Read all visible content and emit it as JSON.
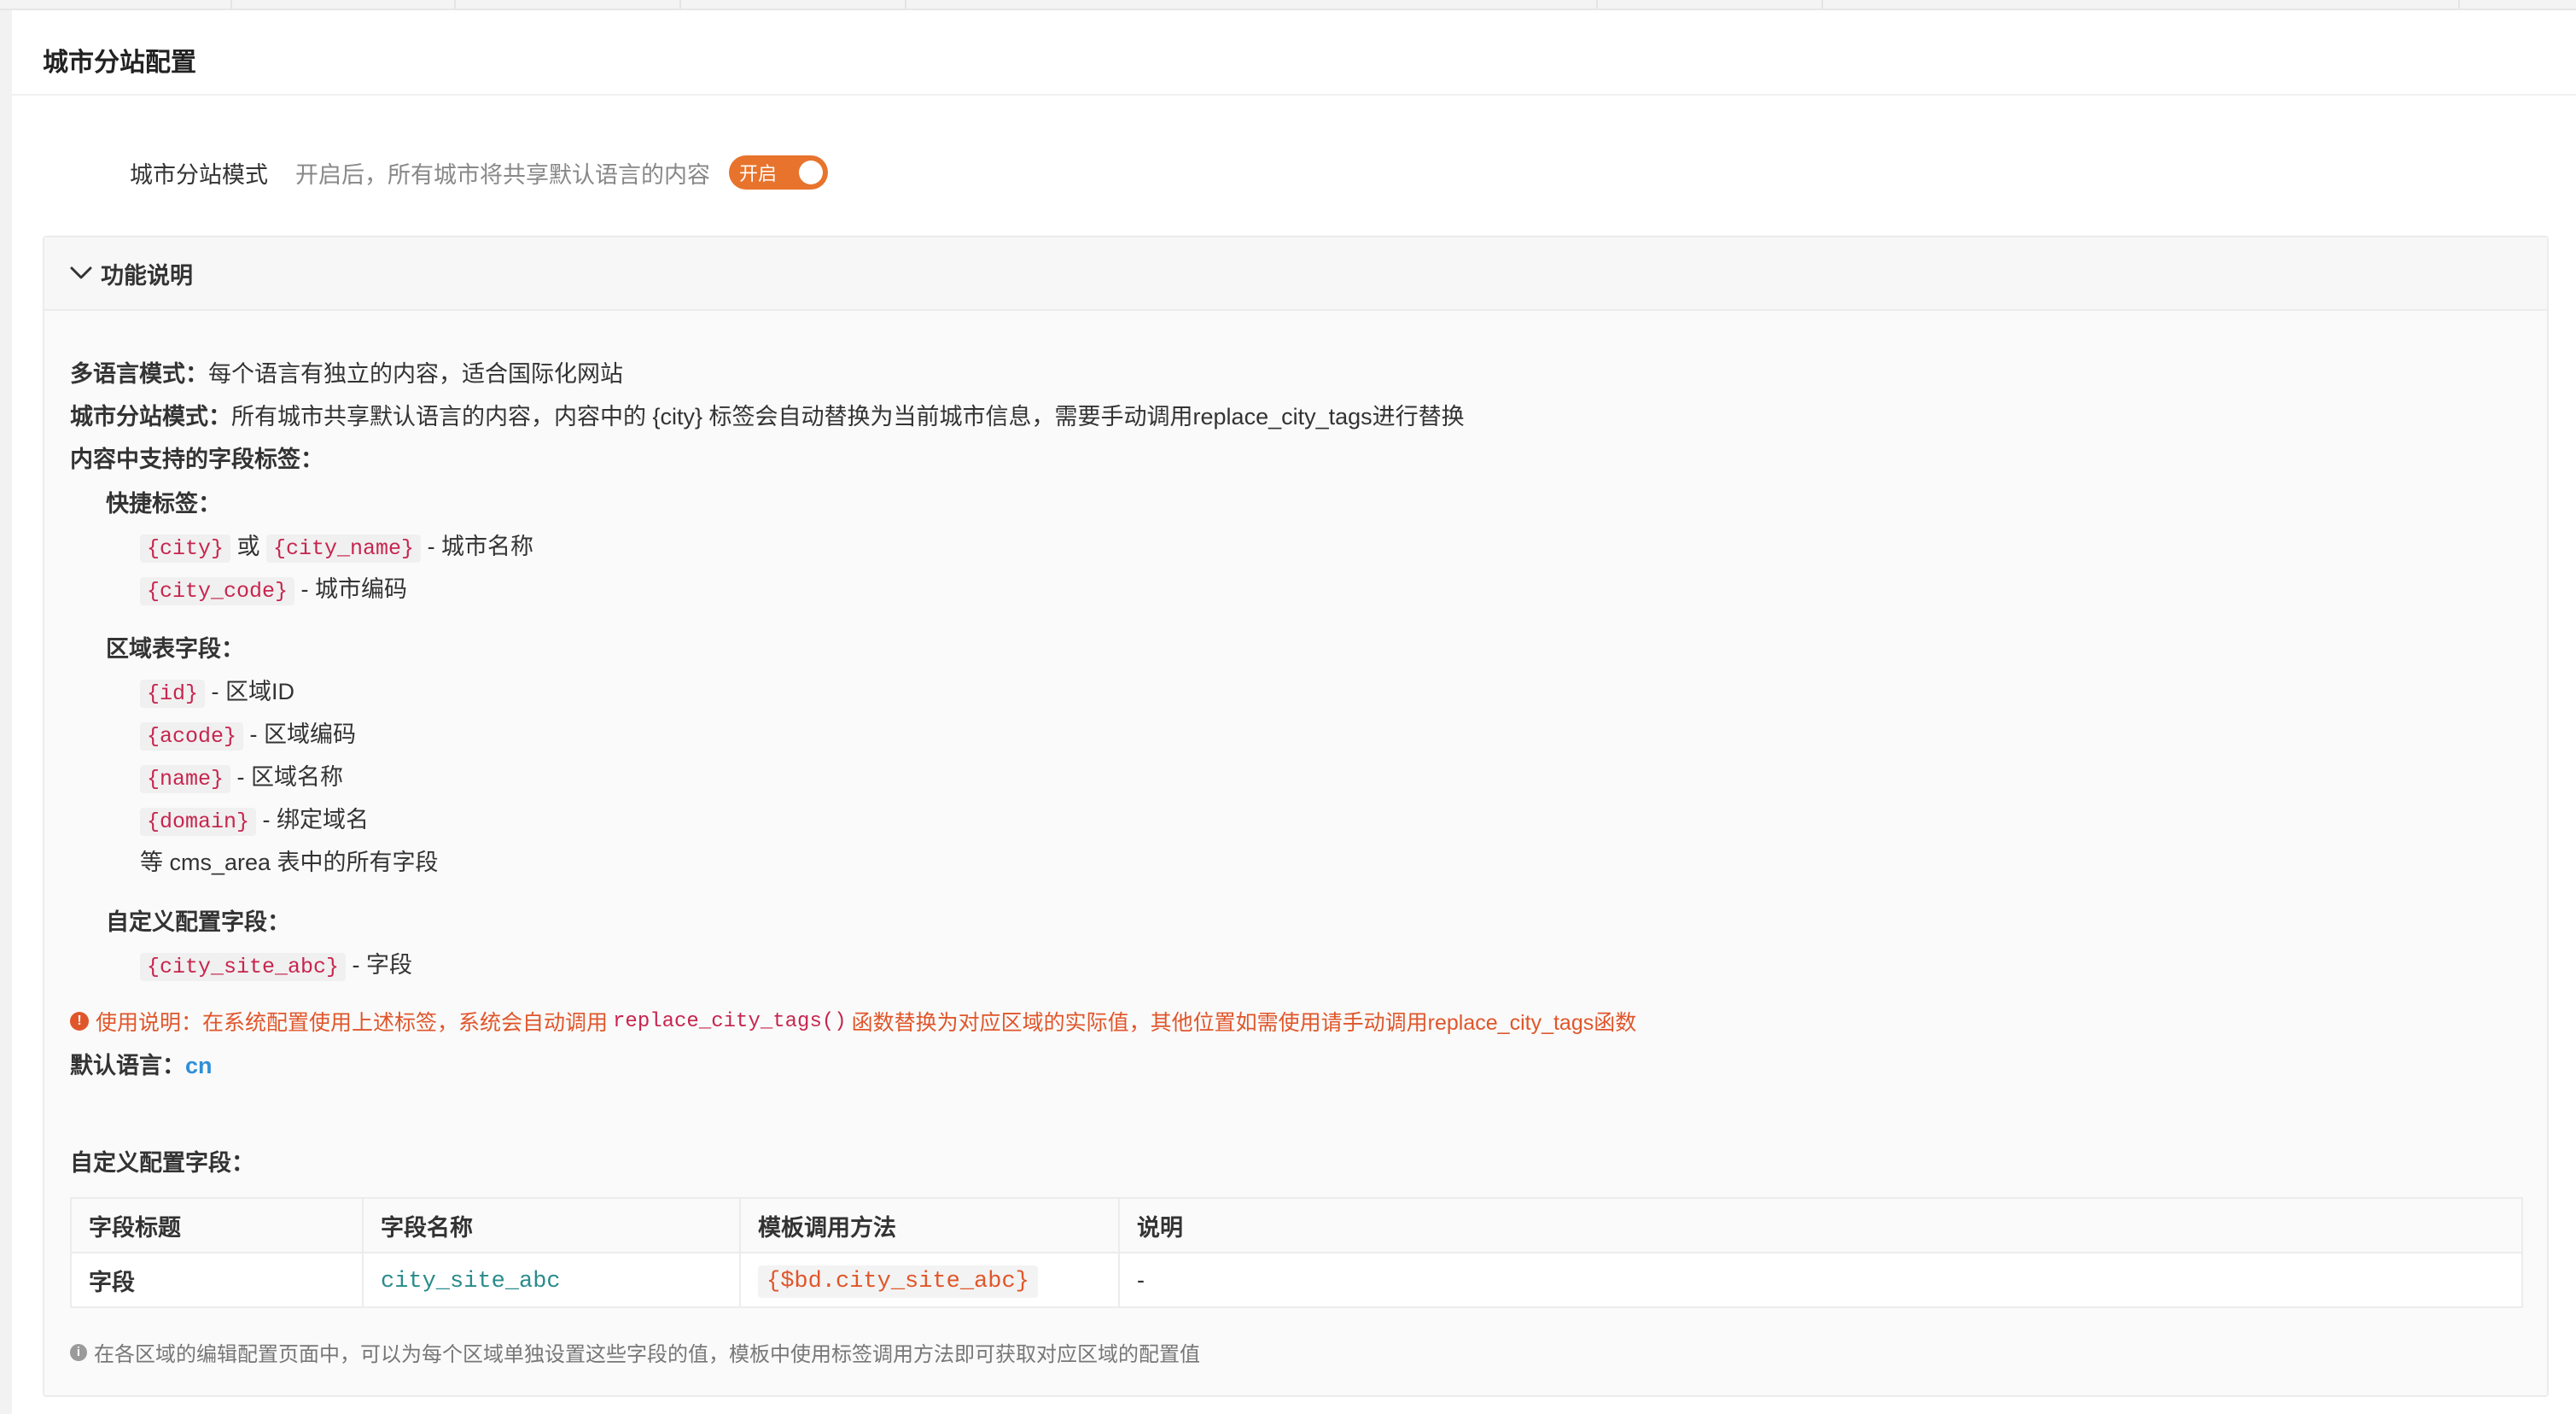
{
  "card": {
    "title": "城市分站配置"
  },
  "city_mode": {
    "label": "城市分站模式",
    "hint": "开启后，所有城市将共享默认语言的内容",
    "switch_label": "开启"
  },
  "collapse": {
    "title": "功能说明",
    "multi_lang_label": "多语言模式：",
    "multi_lang_text": "每个语言有独立的内容，适合国际化网站",
    "city_mode_label": "城市分站模式：",
    "city_mode_text": "所有城市共享默认语言的内容，内容中的 {city} 标签会自动替换为当前城市信息，需要手动调用replace_city_tags进行替换",
    "supported_tags_title": "内容中支持的字段标签：",
    "shortcut_title": "快捷标签：",
    "shortcut": [
      {
        "tag": "{city}",
        "sep": " 或 ",
        "tag2": "{city_name}",
        "desc": " - 城市名称"
      },
      {
        "tag": "{city_code}",
        "desc": " - 城市编码"
      }
    ],
    "area_title": "区域表字段：",
    "area": [
      {
        "tag": "{id}",
        "desc": " - 区域ID"
      },
      {
        "tag": "{acode}",
        "desc": " - 区域编码"
      },
      {
        "tag": "{name}",
        "desc": " - 区域名称"
      },
      {
        "tag": "{domain}",
        "desc": " - 绑定域名"
      }
    ],
    "area_more": "等 cms_area 表中的所有字段",
    "custom_title": "自定义配置字段：",
    "custom": [
      {
        "tag": "{city_site_abc}",
        "desc": " - 字段"
      }
    ],
    "usage_prefix": "使用说明：在系统配置使用上述标签，系统会自动调用",
    "usage_func": "replace_city_tags()",
    "usage_suffix": "函数替换为对应区域的实际值，其他位置如需使用请手动调用replace_city_tags函数",
    "default_lang_label": "默认语言：",
    "default_lang_value": "cn",
    "custom_fields_title": "自定义配置字段：",
    "table": {
      "headers": [
        "字段标题",
        "字段名称",
        "模板调用方法",
        "说明"
      ],
      "rows": [
        {
          "title": "字段",
          "name": "city_site_abc",
          "method": "{$bd.city_site_abc}",
          "note": "-"
        }
      ]
    },
    "footnote": "在各区域的编辑配置页面中，可以为每个区域单独设置这些字段的值，模板中使用标签调用方法即可获取对应区域的配置值"
  },
  "colors": {
    "accent": "#e8732c",
    "warning": "#e0562a",
    "tag_text": "#c7254e",
    "link_blue": "#2f8fd8",
    "teal": "#2a8b8b"
  },
  "icons": {
    "collapse_toggle": "chevron-down-icon",
    "usage_alert": "alert-circle-icon",
    "footnote_info": "info-circle-icon"
  }
}
